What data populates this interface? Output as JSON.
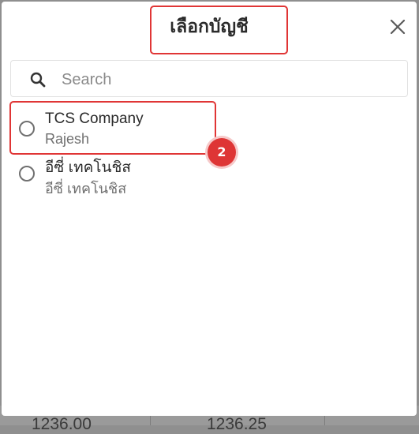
{
  "modal": {
    "title": "เลือกบัญชี",
    "close_icon": "close-icon"
  },
  "search": {
    "placeholder": "Search",
    "value": "",
    "icon": "search-icon"
  },
  "accounts": [
    {
      "name": "TCS Company",
      "sub": "Rajesh",
      "selected": false
    },
    {
      "name": "อีซี่ เทคโนชิส",
      "sub": "อีซี่ เทคโนชิส",
      "selected": false
    }
  ],
  "annotation": {
    "badge": "2",
    "color": "#e03535"
  },
  "background": {
    "values": [
      "1236.00",
      "1236.25"
    ]
  }
}
